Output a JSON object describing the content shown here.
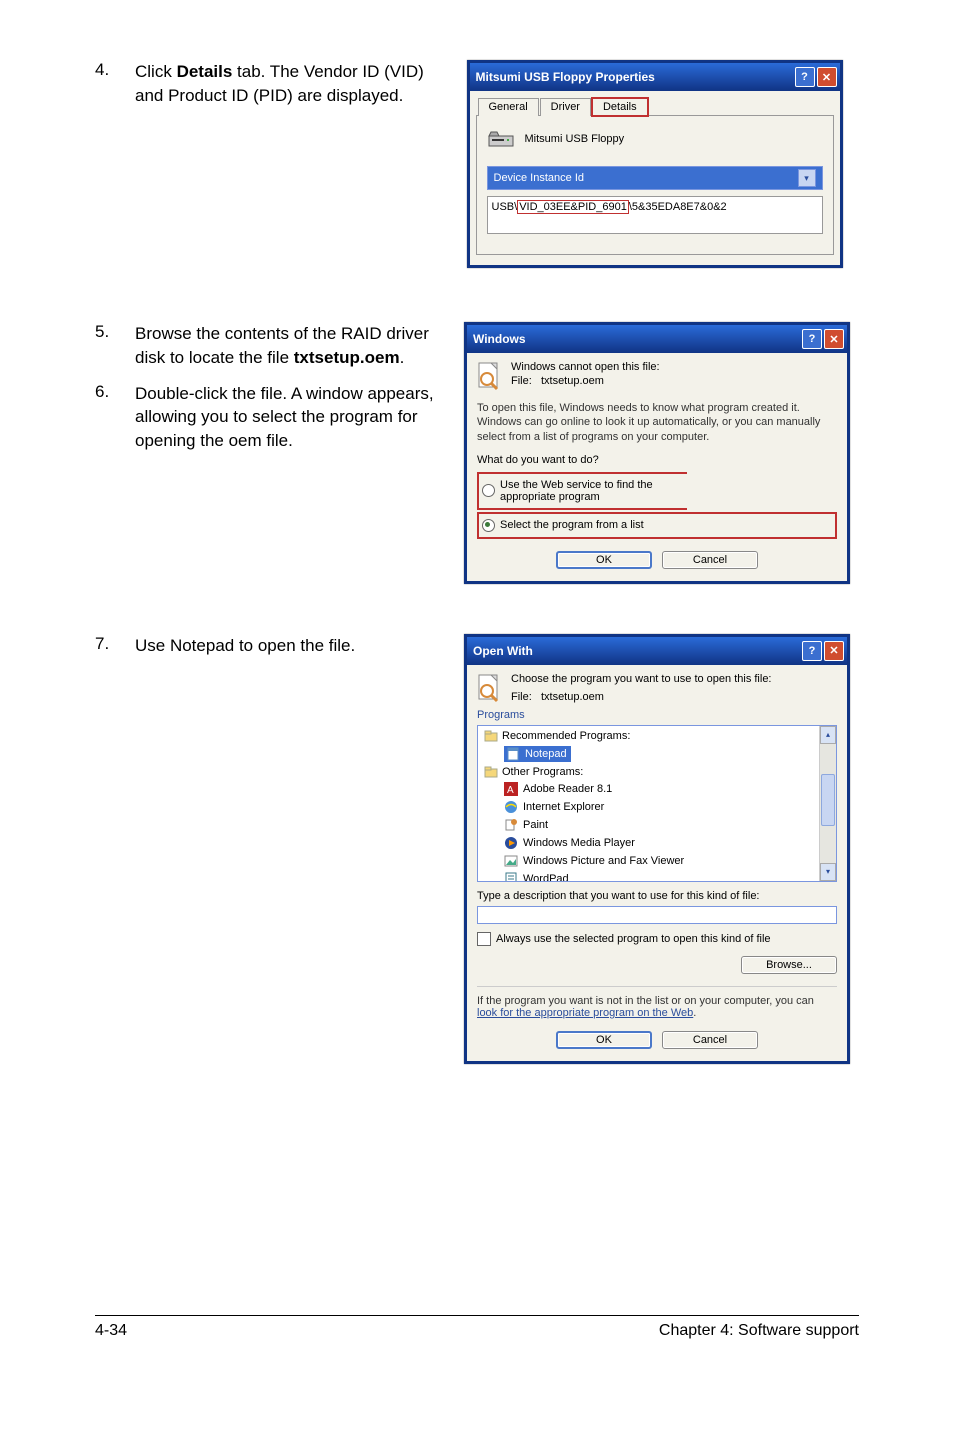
{
  "steps": {
    "s4": {
      "num": "4.",
      "text_a": "Click ",
      "bold1": "Details",
      "text_b": " tab. The Vendor ID (VID) and Product ID (PID) are displayed."
    },
    "s5": {
      "num": "5.",
      "text_a": "Browse the contents of the RAID driver disk to locate the file ",
      "bold1": "txtsetup.oem",
      "text_b": "."
    },
    "s6": {
      "num": "6.",
      "text": "Double-click the file. A window appears, allowing you to select the program for opening the oem file."
    },
    "s7": {
      "num": "7.",
      "text": "Use Notepad to open the file."
    }
  },
  "dlg_props": {
    "title": "Mitsumi USB Floppy Properties",
    "tabs": {
      "general": "General",
      "driver": "Driver",
      "details": "Details"
    },
    "device_name": "Mitsumi USB Floppy",
    "dropdown": "Device Instance Id",
    "id_prefix": "USB\\",
    "id_boxed": "VID_03EE&PID_6901",
    "id_suffix": "\\5&35EDA8E7&0&2"
  },
  "dlg_win": {
    "title": "Windows",
    "cannot_open": "Windows cannot open this file:",
    "file_label": "File:",
    "file_name": "txtsetup.oem",
    "explain": "To open this file, Windows needs to know what program created it. Windows can go online to look it up automatically, or you can manually select from a list of programs on your computer.",
    "question": "What do you want to do?",
    "opt_web": "Use the Web service to find the appropriate program",
    "opt_list": "Select the program from a list",
    "ok": "OK",
    "cancel": "Cancel"
  },
  "dlg_ow": {
    "title": "Open With",
    "choose": "Choose the program you want to use to open this file:",
    "file_label": "File:",
    "file_name": "txtsetup.oem",
    "section": "Programs",
    "group_rec": "Recommended Programs:",
    "notepad": "Notepad",
    "group_other": "Other Programs:",
    "items": {
      "adobe": "Adobe Reader 8.1",
      "ie": "Internet Explorer",
      "paint": "Paint",
      "wmp": "Windows Media Player",
      "wpfv": "Windows Picture and Fax Viewer",
      "wordpad": "WordPad"
    },
    "type_desc": "Type a description that you want to use for this kind of file:",
    "always": "Always use the selected program to open this kind of file",
    "browse": "Browse...",
    "foot_a": "If the program you want is not in the list or on your computer, you can ",
    "foot_link": "look for the appropriate program on the Web",
    "foot_b": ".",
    "ok": "OK",
    "cancel": "Cancel"
  },
  "footer": {
    "left": "4-34",
    "right": "Chapter 4: Software support"
  }
}
